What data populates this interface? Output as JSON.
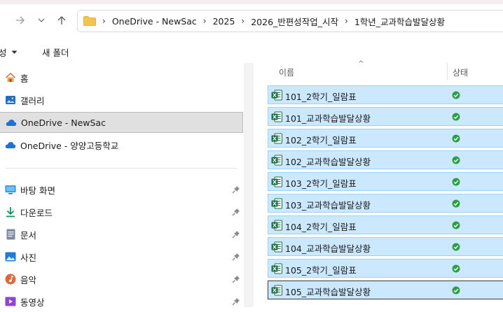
{
  "address": {
    "crumbs": [
      "OneDrive - NewSac",
      "2025",
      "2026_반편성작업_시작",
      "1학년_교과학습발달상황"
    ]
  },
  "commands": {
    "new_partial": "성",
    "new_folder": "새 폴더"
  },
  "sidebar": {
    "items": [
      {
        "label": "홈",
        "icon": "home-icon"
      },
      {
        "label": "갤러리",
        "icon": "gallery-icon"
      },
      {
        "label": "OneDrive - NewSac",
        "icon": "cloud-icon",
        "selected": true
      },
      {
        "label": "OneDrive - 양양고등학교",
        "icon": "cloud-icon"
      },
      {
        "label": "바탕 화면",
        "icon": "desktop-icon",
        "pinned": true
      },
      {
        "label": "다운로드",
        "icon": "download-icon",
        "pinned": true
      },
      {
        "label": "문서",
        "icon": "document-icon",
        "pinned": true
      },
      {
        "label": "사진",
        "icon": "pictures-icon",
        "pinned": true
      },
      {
        "label": "음악",
        "icon": "music-icon",
        "pinned": true
      },
      {
        "label": "동영상",
        "icon": "video-icon",
        "pinned": true
      }
    ]
  },
  "columns": {
    "name": "이름",
    "status": "상태"
  },
  "files": [
    {
      "name": "101_2학기_일람표"
    },
    {
      "name": "101_교과학습발달상황"
    },
    {
      "name": "102_2학기_일람표"
    },
    {
      "name": "102_교과학습발달상황"
    },
    {
      "name": "103_2학기_일람표"
    },
    {
      "name": "103_교과학습발달상황"
    },
    {
      "name": "104_2학기_일람표"
    },
    {
      "name": "104_교과학습발달상황"
    },
    {
      "name": "105_2학기_일람표"
    },
    {
      "name": "105_교과학습발달상황"
    }
  ],
  "colors": {
    "selection": "#cce8ff",
    "selection_border": "#99d1ff",
    "sync_ok": "#2aa044",
    "excel": "#1d7044"
  }
}
